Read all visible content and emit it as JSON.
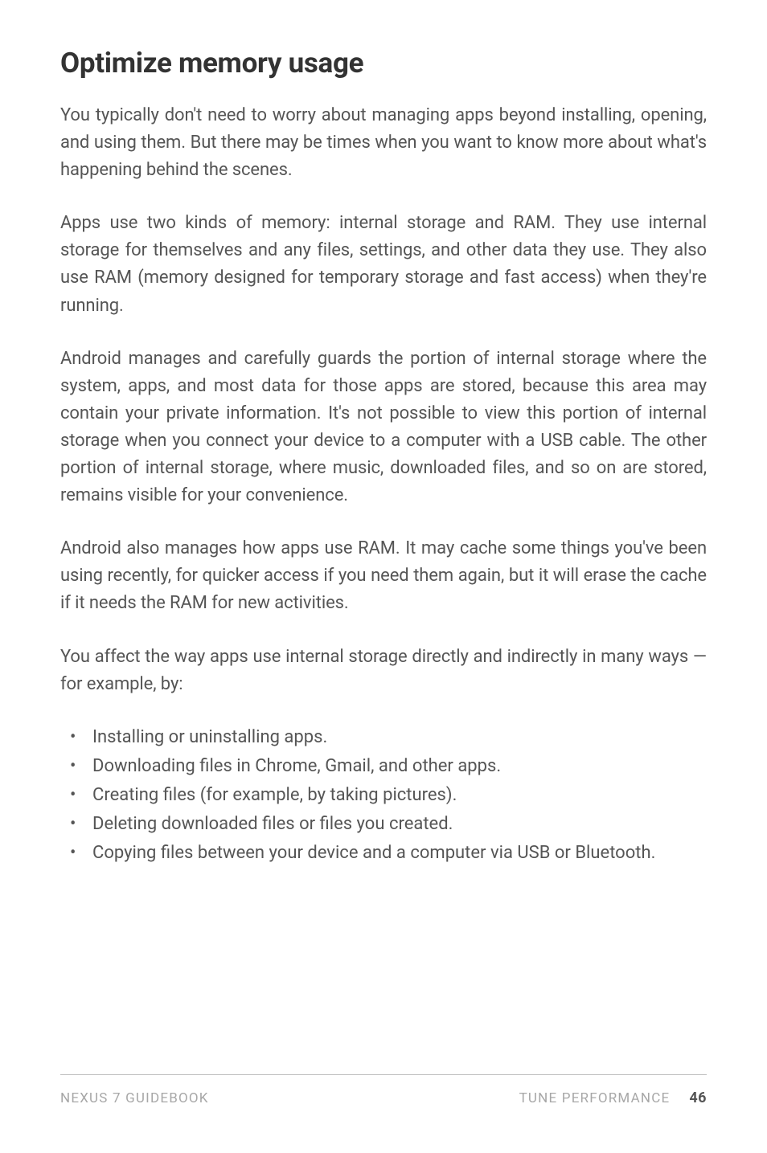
{
  "heading": "Optimize memory usage",
  "paragraphs": {
    "p1": "You typically don't need to worry about managing apps beyond installing, opening, and using them. But there may be times when you want to know more about what's happening behind the scenes.",
    "p2": "Apps use two kinds of memory: internal storage and RAM. They use internal storage for themselves and any files, settings, and other data they use. They also use RAM (memory designed for temporary storage and fast access) when they're running.",
    "p3": "Android manages and carefully guards the portion of internal storage where the system, apps, and most data for those apps are stored, because this area may contain your private information. It's not possible to view this portion of internal storage when you connect your device to a computer with a USB cable. The other portion of internal storage, where music, downloaded files, and so on are stored, remains visible for your convenience.",
    "p4": "Android also manages how apps use RAM. It may cache some things you've been using recently, for quicker access if you need them again, but it will erase the cache if it needs the RAM for new activities.",
    "p5": "You affect the way apps use internal storage directly and indirectly in many ways — for example, by:"
  },
  "bullets": [
    "Installing or uninstalling apps.",
    "Downloading files in Chrome, Gmail, and other apps.",
    "Creating files (for example, by taking pictures).",
    "Deleting downloaded files or files you created.",
    "Copying files between your device and a computer via USB or Bluetooth."
  ],
  "footer": {
    "left": "NEXUS 7 GUIDEBOOK",
    "section": "TUNE PERFORMANCE",
    "page": "46"
  }
}
